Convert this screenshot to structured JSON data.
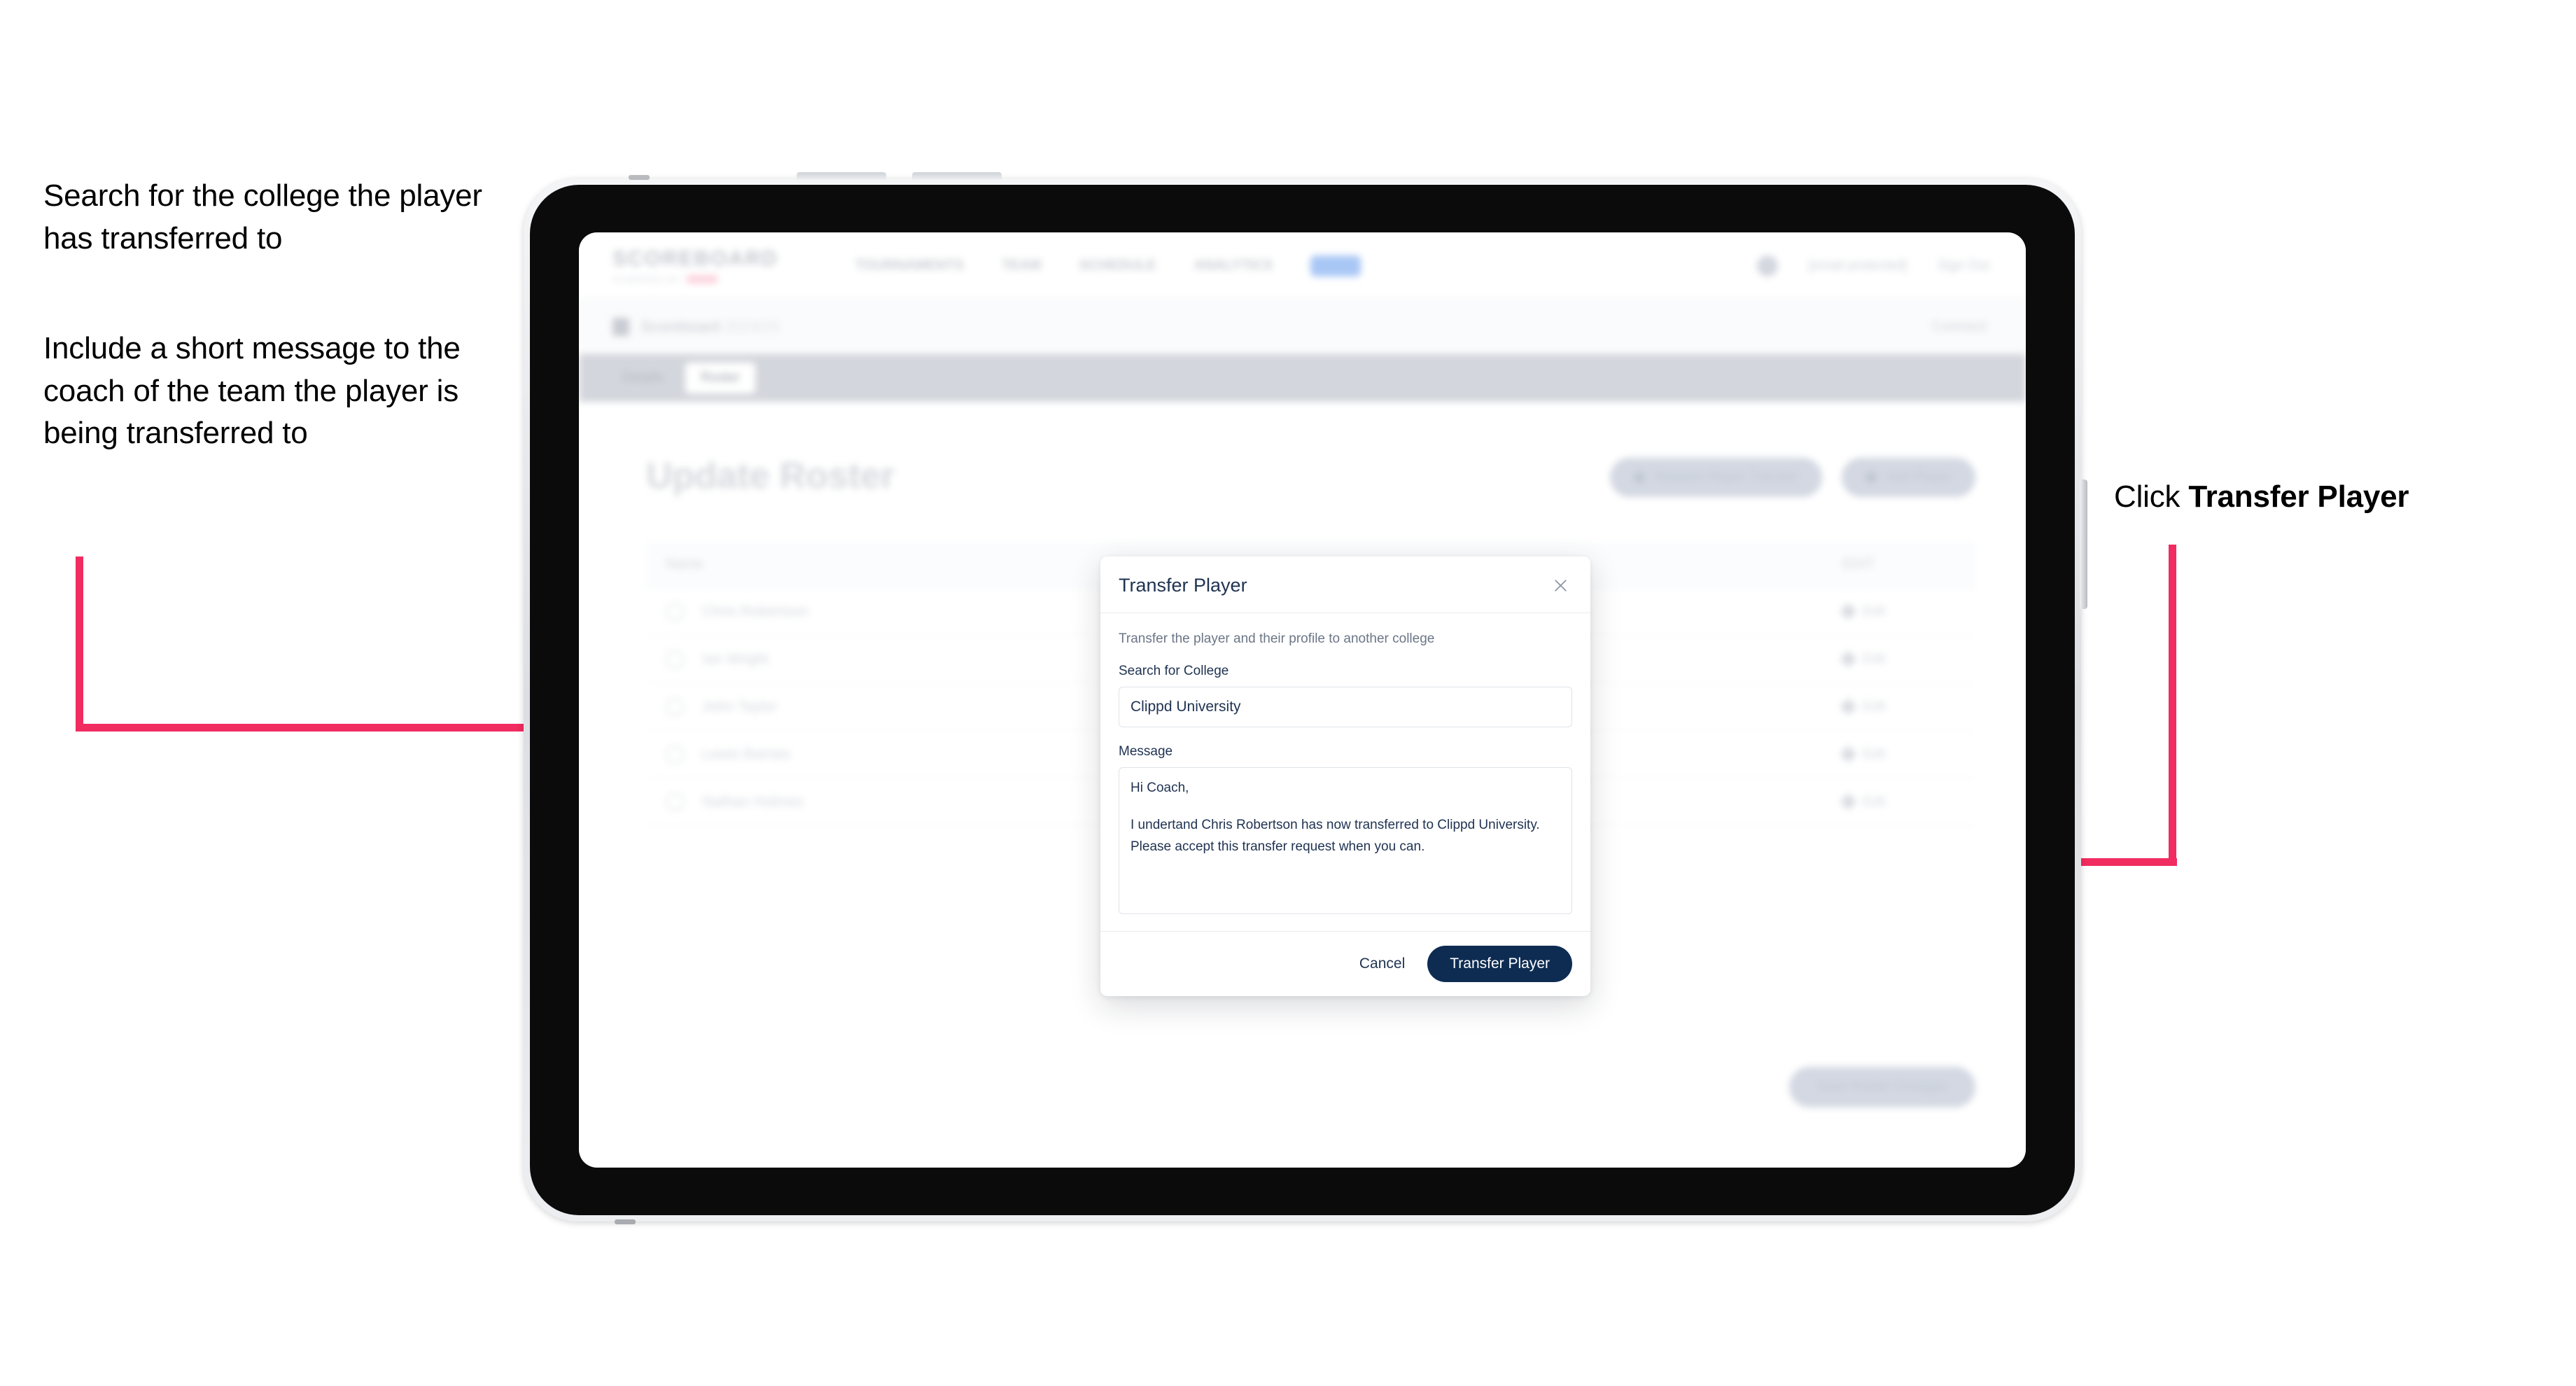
{
  "annotations": {
    "left_1": "Search for the college the player has transferred to",
    "left_2": "Include a short message to the coach of the team the player is being transferred to",
    "right_prefix": "Click ",
    "right_bold": "Transfer Player",
    "arrow_color": "#F12C60"
  },
  "app": {
    "brand": {
      "name": "SCOREBOARD",
      "tagline": "POWERED BY"
    },
    "nav_links": [
      "TOURNAMENTS",
      "TEAM",
      "SCHEDULE",
      "ANALYTICS"
    ],
    "nav_user": "[email protected]",
    "nav_signout": "Sign Out",
    "subbar": {
      "label": "Scoreboard",
      "label_muted": "2024/25",
      "right": "Connect"
    },
    "tabs": [
      {
        "label": "Details",
        "active": false
      },
      {
        "label": "Roster",
        "active": true
      }
    ],
    "page_title": "Update Roster",
    "actions": [
      {
        "label": "Request Player Transfer"
      },
      {
        "label": "Add Player"
      }
    ],
    "table": {
      "columns": [
        "Name",
        "EDIT"
      ],
      "rows": [
        {
          "name": "Chris Robertson",
          "action": "Edit"
        },
        {
          "name": "Ian Wright",
          "action": "Edit"
        },
        {
          "name": "John Taylor",
          "action": "Edit"
        },
        {
          "name": "Lewis Barnes",
          "action": "Edit"
        },
        {
          "name": "Nathan Holmes",
          "action": "Edit"
        }
      ]
    },
    "save_button": "Save Roster Changes"
  },
  "modal": {
    "title": "Transfer Player",
    "close_icon": "close-icon",
    "description": "Transfer the player and their profile to another college",
    "college_label": "Search for College",
    "college_value": "Clippd University",
    "college_placeholder": "Search for College",
    "message_label": "Message",
    "message_line_1": "Hi Coach,",
    "message_line_2": "I undertand Chris Robertson has now transferred to Clippd University.",
    "message_line_3": "Please accept this transfer request when you can.",
    "cancel_label": "Cancel",
    "submit_label": "Transfer Player",
    "submit_color": "#0E2C52"
  }
}
